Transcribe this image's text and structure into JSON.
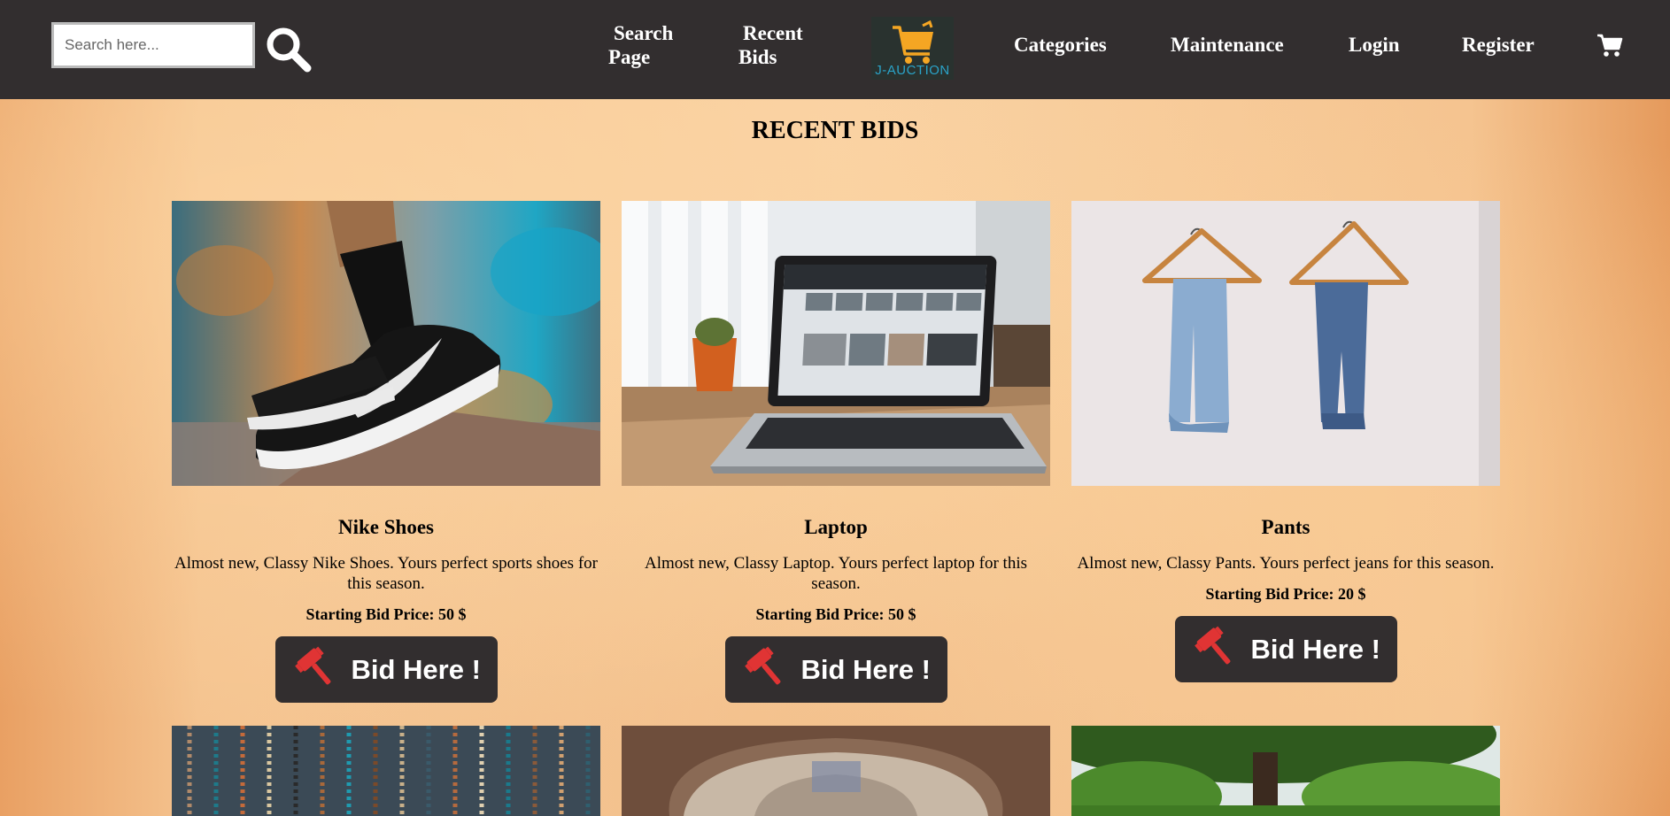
{
  "header": {
    "search_placeholder": "Search here...",
    "nav": {
      "search_page": [
        "Search",
        "Page"
      ],
      "recent_bids": [
        "Recent",
        "Bids"
      ],
      "categories": "Categories",
      "maintenance": "Maintenance",
      "login": "Login",
      "register": "Register"
    },
    "logo_text": "J-AUCTION",
    "icons": {
      "search": "search-icon",
      "cart": "cart-icon",
      "logo": "shopping-cart-logo"
    }
  },
  "main": {
    "title": "RECENT BIDS",
    "items": [
      {
        "name": "Nike Shoes",
        "description": "Almost new, Classy Nike Shoes. Yours perfect sports shoes for this season.",
        "price": "Starting Bid Price: 50 $",
        "button": "Bid Here !"
      },
      {
        "name": "Laptop",
        "description": "Almost new, Classy Laptop. Yours perfect laptop for this season.",
        "price": "Starting Bid Price: 50 $",
        "button": "Bid Here !"
      },
      {
        "name": "Pants",
        "description": "Almost new, Classy Pants. Yours perfect jeans for this season.",
        "price": "Starting Bid Price: 20 $",
        "button": "Bid Here !"
      }
    ]
  },
  "colors": {
    "navbar": "#322e2f",
    "button": "#322e2f",
    "gavel": "#e03434",
    "logo_accent": "#f5a623",
    "logo_text": "#2aa3c8"
  }
}
